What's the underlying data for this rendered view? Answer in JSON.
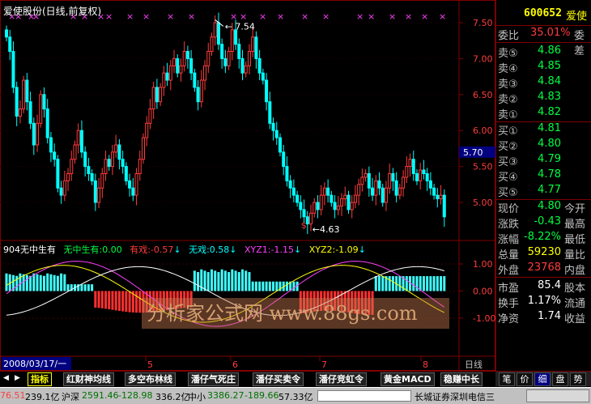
{
  "chart_title": "爱使股份(日线,前复权)",
  "price_axis": [
    "7.50",
    "7.00",
    "6.50",
    "6.00",
    "5.70",
    "5.50",
    "5.00"
  ],
  "price_marker": "5.70",
  "indicator_axis": [
    "1.00",
    "0.00",
    "-1.00"
  ],
  "annotations": {
    "high": "7.54",
    "low": "4.63",
    "signal": "$"
  },
  "indicator_header": {
    "name": "904无中生有",
    "l1": "无中生有:0.00",
    "l2": "有戏:-0.57",
    "l3": "无戏:0.58",
    "l4": "XYZ1:-1.15",
    "l5": "XYZ2:-1.09"
  },
  "time_axis": {
    "start": "2008/03/17/一",
    "months": [
      "5",
      "6",
      "7",
      "8"
    ],
    "period": "日线"
  },
  "watermark": "分析家公式网 www.88gs.com",
  "quote": {
    "header_code": "600652",
    "header_name": "爱使",
    "weibi_label": "委比",
    "weibi_val": "35.01%",
    "weicha_label": "委差",
    "asks": [
      {
        "label": "卖⑤",
        "price": "4.86"
      },
      {
        "label": "卖④",
        "price": "4.85"
      },
      {
        "label": "卖③",
        "price": "4.84"
      },
      {
        "label": "卖②",
        "price": "4.83"
      },
      {
        "label": "卖①",
        "price": "4.82"
      }
    ],
    "bids": [
      {
        "label": "买①",
        "price": "4.81"
      },
      {
        "label": "买②",
        "price": "4.80"
      },
      {
        "label": "买③",
        "price": "4.79"
      },
      {
        "label": "买④",
        "price": "4.78"
      },
      {
        "label": "买⑤",
        "price": "4.77"
      }
    ],
    "stats": [
      {
        "label": "现价",
        "val": "4.80",
        "color": "green",
        "extra": "今开"
      },
      {
        "label": "涨跌",
        "val": "-0.43",
        "color": "green",
        "extra": "最高"
      },
      {
        "label": "涨幅",
        "val": "-8.22%",
        "color": "green",
        "extra": "最低"
      },
      {
        "label": "总量",
        "val": "59230",
        "color": "yellow",
        "extra": "量比"
      },
      {
        "label": "外盘",
        "val": "23768",
        "color": "red",
        "extra": "内盘"
      }
    ],
    "stats2": [
      {
        "label": "市盈",
        "val": "85.4",
        "extra": "股本"
      },
      {
        "label": "换手",
        "val": "1.17%",
        "extra": "流通"
      },
      {
        "label": "净资",
        "val": "1.74",
        "extra": "收益"
      }
    ]
  },
  "tabs": [
    "指标",
    "红财神均线",
    "多空布林线",
    "潘仔气死庄",
    "潘仔买卖令",
    "潘仔竞虹令",
    "黄金MACD",
    "稳赚中长"
  ],
  "right_tabs": [
    "笔",
    "价",
    "细",
    "盘",
    "势"
  ],
  "status": {
    "sh": "76.51",
    "sh_vol": "239.1亿",
    "hs_label": "沪深",
    "hs_val": "2591.46",
    "hs_chg": "-128.98",
    "hs_vol": "336.2亿",
    "zx_label": "中小",
    "zx_val": "3386.27",
    "zx_chg": "-189.66",
    "zx_vol": "57.33亿",
    "broker": "长城证券深圳电信三"
  },
  "colors": {
    "up": "#ff3c3c",
    "down": "#00ffff",
    "bg": "#000000",
    "frame": "#800000"
  }
}
